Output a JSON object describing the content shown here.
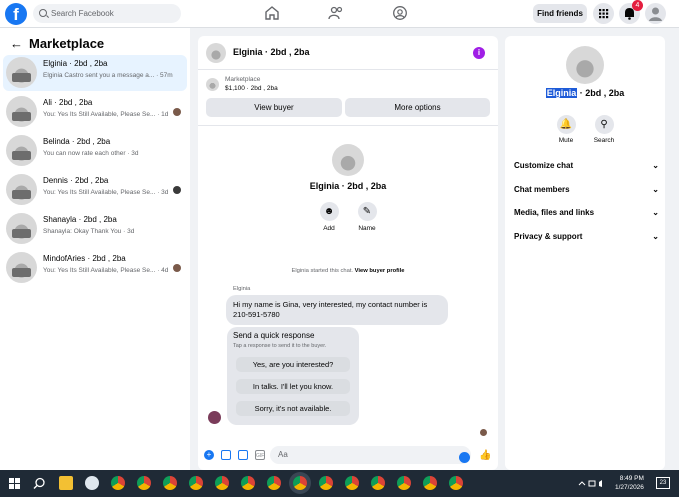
{
  "topbar": {
    "search_placeholder": "Search Facebook",
    "find_friends": "Find friends",
    "notif_count": "4",
    "brand_color": "#1877f2"
  },
  "sidebar": {
    "title": "Marketplace",
    "conversations": [
      {
        "name": "Elginia · 2bd , 2ba",
        "preview": "Elginia Castro sent you a message a... · 57m"
      },
      {
        "name": "Ali · 2bd , 2ba",
        "preview": "You: Yes Its Still Available, Please Se... · 1d"
      },
      {
        "name": "Belinda · 2bd , 2ba",
        "preview": "You can now rate each other · 3d"
      },
      {
        "name": "Dennis · 2bd , 2ba",
        "preview": "You: Yes Its Still Available, Please Se... · 3d"
      },
      {
        "name": "Shanayla · 2bd , 2ba",
        "preview": "Shanayla: Okay Thank You · 3d"
      },
      {
        "name": "MindofAries · 2bd , 2ba",
        "preview": "You: Yes Its Still Available, Please Se... · 4d"
      }
    ]
  },
  "chat": {
    "title": "Elginia · 2bd , 2ba",
    "listing_label": "Marketplace",
    "listing_price": "$1,100 · 2bd , 2ba",
    "view_buyer": "View buyer",
    "more_options": "More options",
    "profile_name": "Elginia · 2bd , 2ba",
    "add_label": "Add",
    "name_label": "Name",
    "started_text": "Elginia started this chat.",
    "view_profile": "View buyer profile",
    "sender": "Elginia",
    "message": "Hi my name is Gina,  very interested,  my contact number is 210-591-5780",
    "quick_title": "Send a quick response",
    "quick_subtitle": "Tap a response to send it to the buyer.",
    "quick_options": [
      "Yes, are you interested?",
      "In talks. I'll let you know.",
      "Sorry, it's not available."
    ],
    "input_placeholder": "Aa"
  },
  "details": {
    "name_highlight": "Elginia",
    "name_rest": " · 2bd , 2ba",
    "mute": "Mute",
    "search": "Search",
    "items": [
      "Customize chat",
      "Chat members",
      "Media, files and links",
      "Privacy & support"
    ]
  },
  "taskbar": {
    "time": "8:49 PM",
    "date": "1/27/2026",
    "notifications": "23"
  }
}
